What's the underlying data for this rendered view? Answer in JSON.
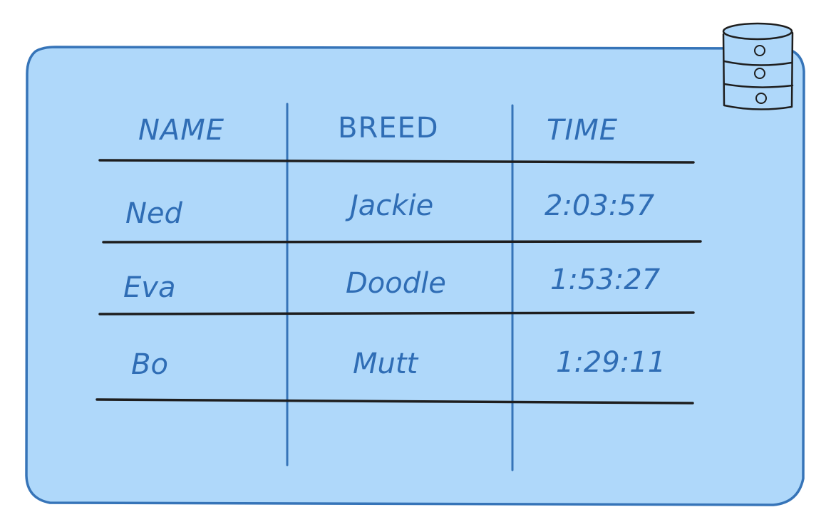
{
  "colors": {
    "panel_fill": "#afd8fa",
    "panel_stroke": "#3674b8",
    "text": "#2f6db5",
    "row_line": "#1e1e1e",
    "column_line": "#3674b8",
    "database_stroke": "#1e1e1e"
  },
  "icon": {
    "name": "database-icon"
  },
  "table": {
    "headers": [
      "NAME",
      "BREED",
      "TIME"
    ],
    "rows": [
      {
        "name": "Ned",
        "breed": "Jackie",
        "time": "2:03:57"
      },
      {
        "name": "Eva",
        "breed": "Doodle",
        "time": "1:53:27"
      },
      {
        "name": "Bo",
        "breed": "Mutt",
        "time": "1:29:11"
      }
    ]
  }
}
